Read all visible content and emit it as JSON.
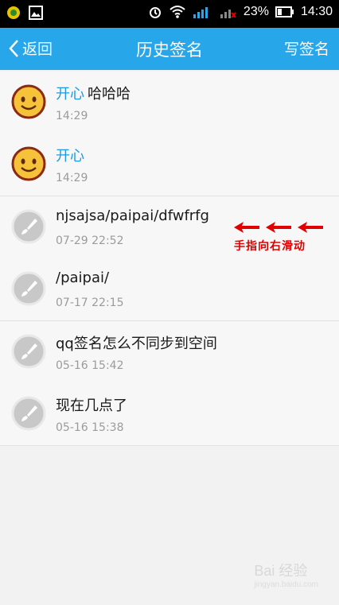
{
  "status_bar": {
    "battery_percent": "23%",
    "time": "14:30"
  },
  "header": {
    "back_label": "返回",
    "title": "历史签名",
    "write_label": "写签名"
  },
  "signatures": [
    {
      "mood": "开心",
      "text": "哈哈哈",
      "time": "14:29",
      "avatar": "smiley-avatar"
    },
    {
      "mood": "开心",
      "text": "",
      "time": "14:29",
      "avatar": "smiley-avatar"
    },
    {
      "mood": "",
      "text": "njsajsa/paipai/dfwfrfg",
      "time": "07-29 22:52",
      "avatar": "brush-icon"
    },
    {
      "mood": "",
      "text": "/paipai/",
      "time": "07-17 22:15",
      "avatar": "brush-icon"
    },
    {
      "mood": "",
      "text": "qq签名怎么不同步到空间",
      "time": "05-16 15:42",
      "avatar": "brush-icon"
    },
    {
      "mood": "",
      "text": "现在几点了",
      "time": "05-16 15:38",
      "avatar": "brush-icon"
    }
  ],
  "annotation": {
    "text": "手指向右滑动"
  },
  "watermark": {
    "text": "Bai 经验",
    "sub": "jingyan.baidu.com"
  },
  "colors": {
    "appbar": "#27a6ea",
    "mood": "#1e9be0",
    "annotation": "#e00000"
  }
}
